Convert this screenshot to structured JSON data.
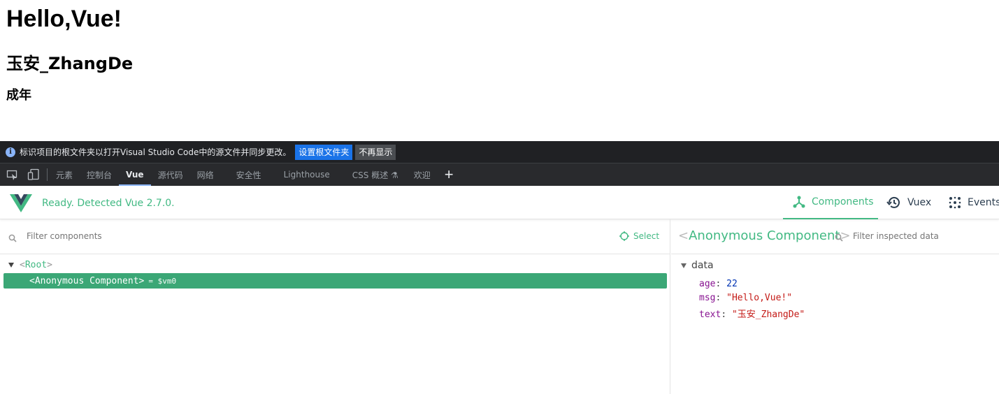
{
  "page": {
    "h1": "Hello,Vue!",
    "h2": "玉安_ZhangDe",
    "h3": "成年"
  },
  "infobar": {
    "message": "标识项目的根文件夹以打开Visual Studio Code中的源文件并同步更改。",
    "primary_btn": "设置根文件夹",
    "secondary_btn": "不再显示"
  },
  "devtools_tabs": [
    {
      "label": "元素"
    },
    {
      "label": "控制台"
    },
    {
      "label": "Vue"
    },
    {
      "label": "源代码"
    },
    {
      "label": "网络"
    },
    {
      "label": "安全性"
    },
    {
      "label": "Lighthouse"
    },
    {
      "label": "CSS 概述 ⚗"
    },
    {
      "label": "欢迎"
    }
  ],
  "vue_header": {
    "status": "Ready. Detected Vue 2.7.0.",
    "tabs": {
      "components": "Components",
      "vuex": "Vuex",
      "events": "Events"
    }
  },
  "left_pane": {
    "filter_placeholder": "Filter components",
    "select_label": "Select",
    "root": {
      "open": "<",
      "name": "Root",
      "close": ">"
    },
    "selected": {
      "label": "<Anonymous Component>",
      "vm": "= $vm0"
    }
  },
  "right_pane": {
    "component_name": "Anonymous Component",
    "bracket_open": "<",
    "bracket_close": ">",
    "filter_placeholder": "Filter inspected data",
    "section": "data",
    "props": [
      {
        "key": "age",
        "value": "22"
      },
      {
        "key": "msg",
        "value": "\"Hello,Vue!\""
      },
      {
        "key": "text",
        "value": "\"玉安_ZhangDe\""
      }
    ]
  },
  "colors": {
    "vue_green": "#42b983",
    "selected_row": "#3ba776",
    "devtools_bg": "#292a2d",
    "infobar_bg": "#202124",
    "primary_btn": "#1a73e8"
  }
}
